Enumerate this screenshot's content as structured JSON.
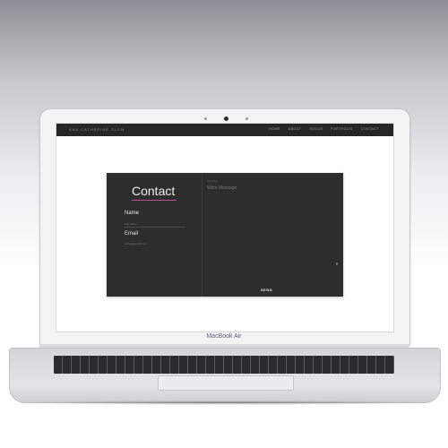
{
  "device": {
    "brand_label": "MacBook Air"
  },
  "site": {
    "brand": "ANA CATHERINE OLEM",
    "nav_links": [
      "HOME",
      "ABOUT",
      "SKILLS",
      "PORTFOLIO",
      "CONTACT"
    ]
  },
  "contact_form": {
    "title": "Contact",
    "name_label": "Name",
    "name_placeholder": "Full Name",
    "email_label": "Email",
    "email_placeholder": "name@gmail.com",
    "message_section_label": "Message",
    "message_placeholder": "Write Message",
    "send_label": "SEND"
  },
  "colors": {
    "nav_bg": "#262626",
    "card_bg": "#2d2d2d",
    "accent_underline": "#b5508a"
  }
}
